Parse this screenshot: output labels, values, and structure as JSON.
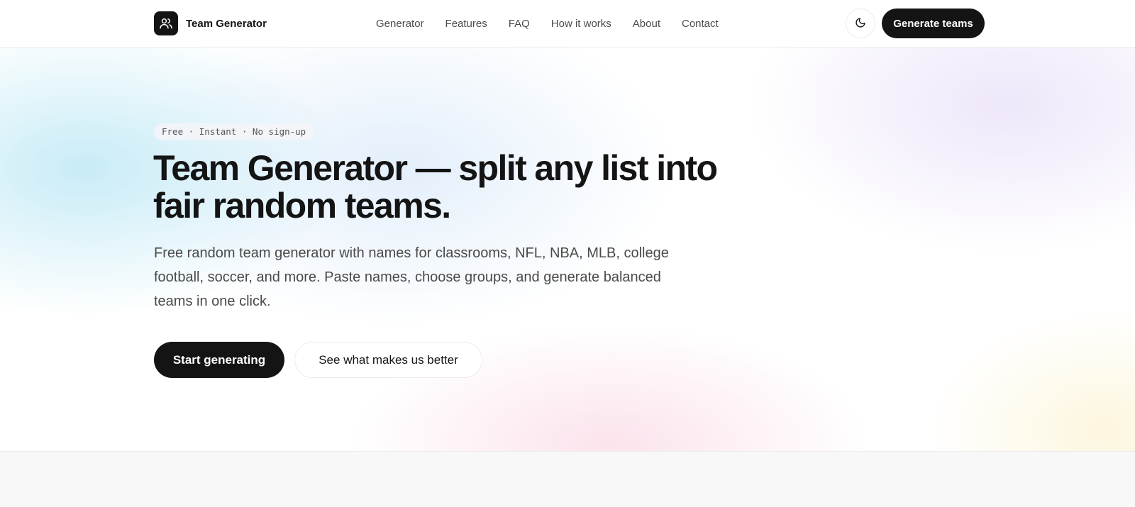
{
  "brand": {
    "name": "Team Generator",
    "logo_icon": "users-icon"
  },
  "nav": {
    "items": [
      {
        "label": "Generator"
      },
      {
        "label": "Features"
      },
      {
        "label": "FAQ"
      },
      {
        "label": "How it works"
      },
      {
        "label": "About"
      },
      {
        "label": "Contact"
      }
    ]
  },
  "header": {
    "theme_toggle_icon": "moon-icon",
    "cta_label": "Generate teams"
  },
  "hero": {
    "pill": "Free · Instant · No sign-up",
    "headline": "Team Generator — split any list into fair random teams.",
    "subtext": "Free random team generator with names for classrooms, NFL, NBA, MLB, college football, soccer, and more. Paste names, choose groups, and generate balanced teams in one click.",
    "primary_button": "Start generating",
    "secondary_button": "See what makes us better"
  },
  "colors": {
    "text": "#141414",
    "button_dark": "#141414",
    "muted": "#4a4a4a"
  }
}
